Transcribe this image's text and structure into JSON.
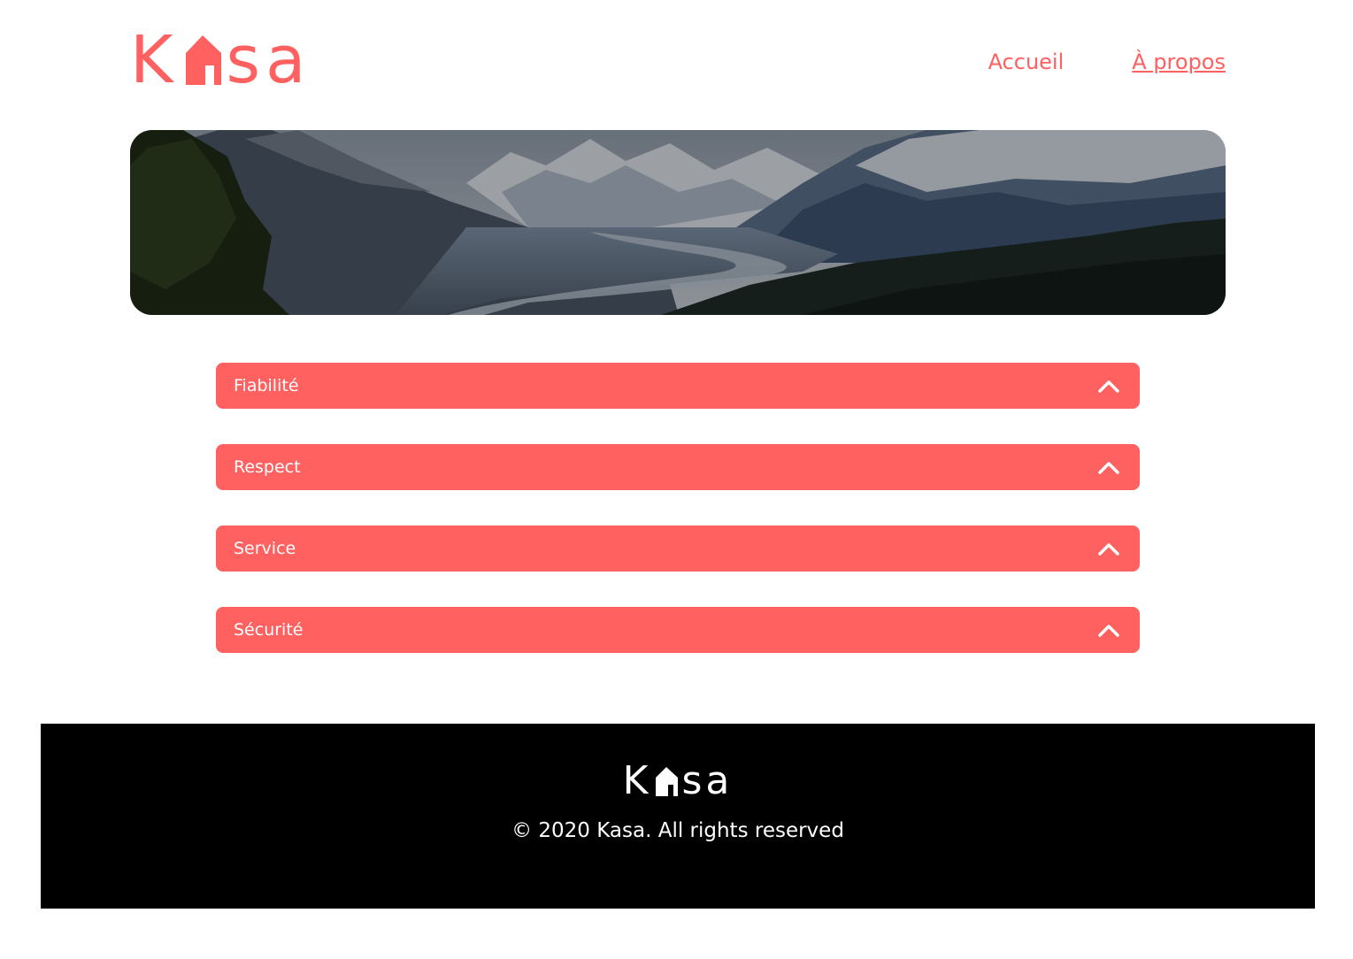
{
  "colors": {
    "accent": "#ff6060",
    "footer_bg": "#000000",
    "text_on_accent": "#ffffff"
  },
  "header": {
    "logo": {
      "prefix": "K",
      "suffix": "sa",
      "icon": "house-icon"
    },
    "nav": [
      {
        "label": "Accueil",
        "active": false
      },
      {
        "label": "À propos",
        "active": true
      }
    ]
  },
  "banner": {
    "image": "mountain-landscape"
  },
  "collapses": [
    {
      "title": "Fiabilité",
      "icon": "chevron-up-icon"
    },
    {
      "title": "Respect",
      "icon": "chevron-up-icon"
    },
    {
      "title": "Service",
      "icon": "chevron-up-icon"
    },
    {
      "title": "Sécurité",
      "icon": "chevron-up-icon"
    }
  ],
  "footer": {
    "logo": {
      "prefix": "K",
      "suffix": "sa",
      "icon": "house-icon"
    },
    "copyright": "© 2020 Kasa. All rights reserved"
  }
}
